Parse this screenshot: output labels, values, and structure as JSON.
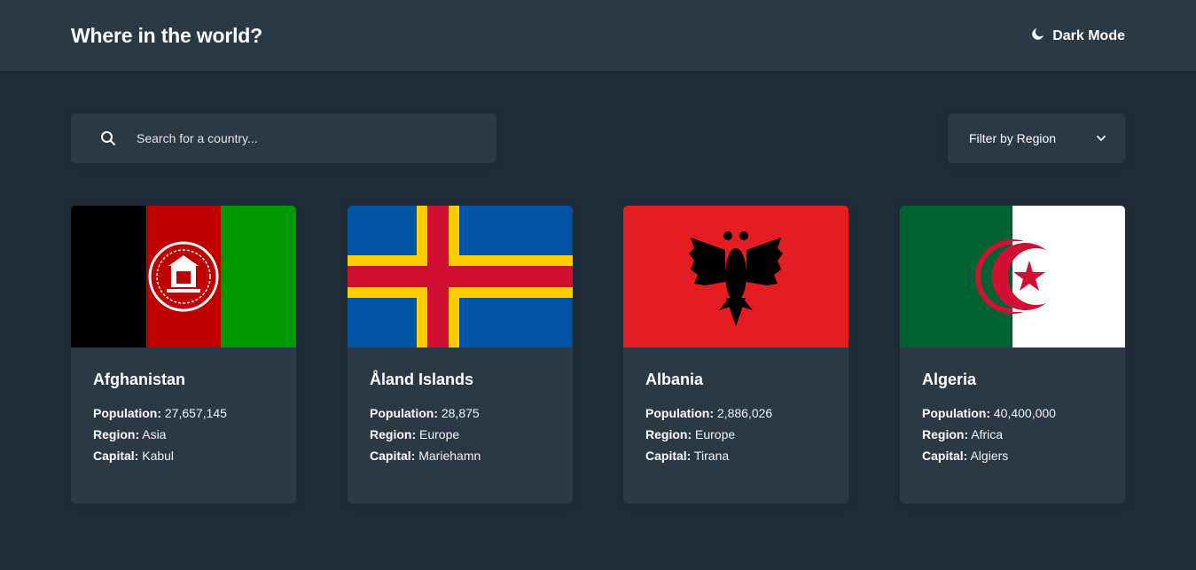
{
  "header": {
    "title": "Where in the world?",
    "mode_label": "Dark Mode",
    "mode_icon": "moon-icon"
  },
  "search": {
    "placeholder": "Search for a country...",
    "value": "",
    "icon": "search-icon"
  },
  "filter": {
    "label": "Filter by Region",
    "icon": "chevron-down-icon"
  },
  "labels": {
    "population": "Population:",
    "region": "Region:",
    "capital": "Capital:"
  },
  "countries": [
    {
      "name": "Afghanistan",
      "population": "27,657,145",
      "region": "Asia",
      "capital": "Kabul",
      "flag": "afghanistan-flag"
    },
    {
      "name": "Åland Islands",
      "population": "28,875",
      "region": "Europe",
      "capital": "Mariehamn",
      "flag": "aland-islands-flag"
    },
    {
      "name": "Albania",
      "population": "2,886,026",
      "region": "Europe",
      "capital": "Tirana",
      "flag": "albania-flag"
    },
    {
      "name": "Algeria",
      "population": "40,400,000",
      "region": "Africa",
      "capital": "Algiers",
      "flag": "algeria-flag"
    }
  ],
  "colors": {
    "background": "#202c37",
    "elements": "#2b3945",
    "text": "#ffffff"
  }
}
